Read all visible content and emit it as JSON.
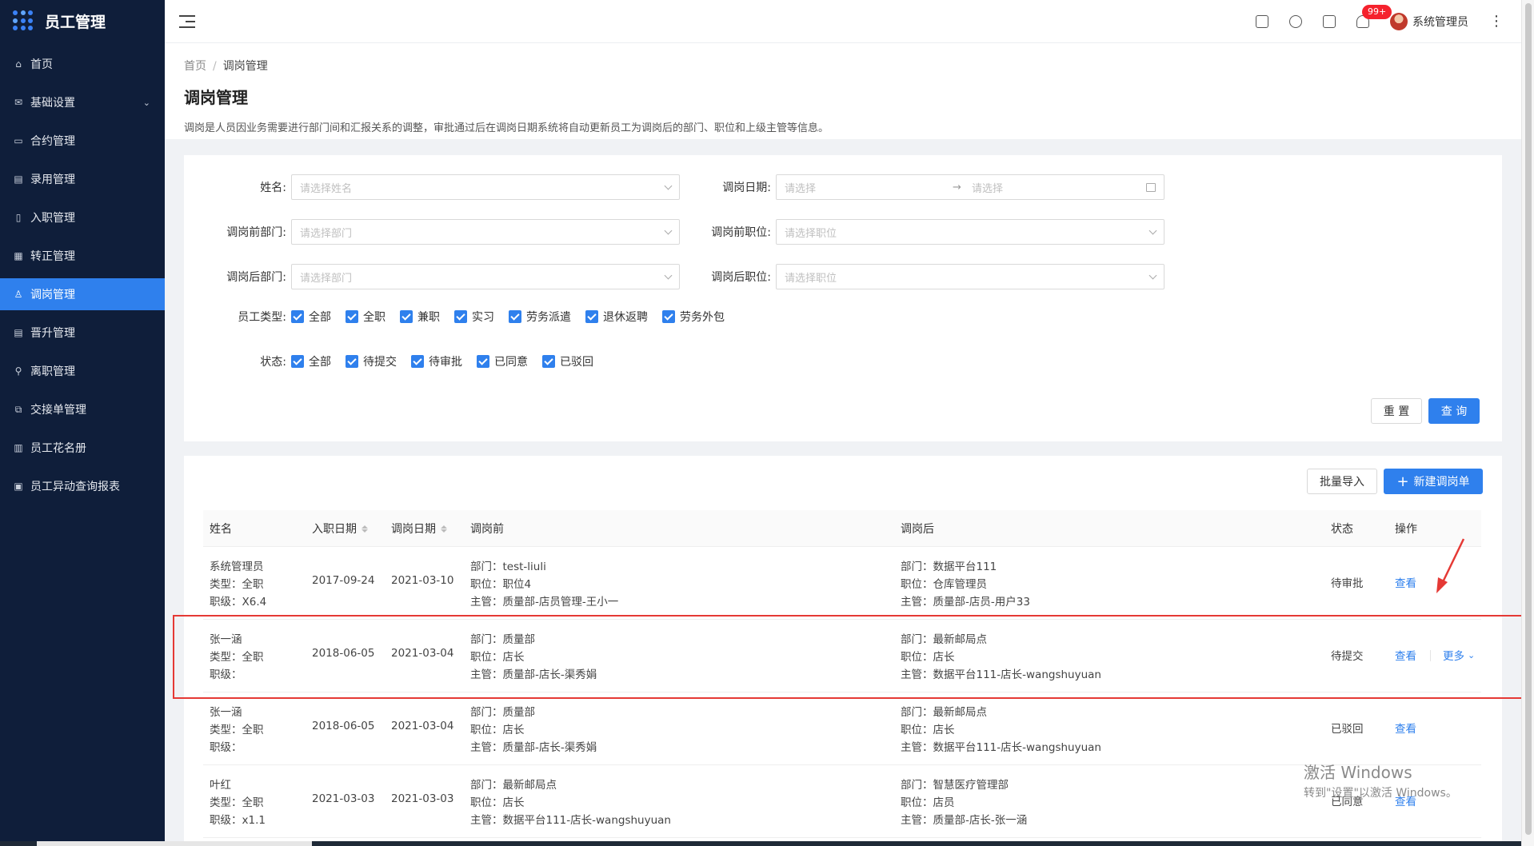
{
  "app": {
    "title": "员工管理"
  },
  "sidebar": {
    "items": [
      {
        "label": "首页",
        "icon": "home-icon"
      },
      {
        "label": "基础设置",
        "icon": "mail-icon",
        "has_caret": true
      },
      {
        "label": "合约管理",
        "icon": "calendar-icon"
      },
      {
        "label": "录用管理",
        "icon": "doc-icon"
      },
      {
        "label": "入职管理",
        "icon": "file-icon"
      },
      {
        "label": "转正管理",
        "icon": "grid-icon"
      },
      {
        "label": "调岗管理",
        "icon": "user-icon",
        "active": true
      },
      {
        "label": "晋升管理",
        "icon": "doc-icon"
      },
      {
        "label": "离职管理",
        "icon": "leave-icon"
      },
      {
        "label": "交接单管理",
        "icon": "copy-icon"
      },
      {
        "label": "员工花名册",
        "icon": "book-icon"
      },
      {
        "label": "员工异动查询报表",
        "icon": "report-icon"
      }
    ]
  },
  "header": {
    "notification_badge": "99+",
    "user_name": "系统管理员"
  },
  "breadcrumb": {
    "home": "首页",
    "current": "调岗管理",
    "separator": "/"
  },
  "page": {
    "title": "调岗管理",
    "description": "调岗是人员因业务需要进行部门间和汇报关系的调整，审批通过后在调岗日期系统将自动更新员工为调岗后的部门、职位和上级主管等信息。"
  },
  "filters": {
    "name_label": "姓名:",
    "name_placeholder": "请选择姓名",
    "date_label": "调岗日期:",
    "date_start_placeholder": "请选择",
    "date_end_placeholder": "请选择",
    "date_arrow": "→",
    "before_dept_label": "调岗前部门:",
    "before_dept_placeholder": "请选择部门",
    "before_pos_label": "调岗前职位:",
    "before_pos_placeholder": "请选择职位",
    "after_dept_label": "调岗后部门:",
    "after_dept_placeholder": "请选择部门",
    "after_pos_label": "调岗后职位:",
    "after_pos_placeholder": "请选择职位",
    "emp_type_label": "员工类型:",
    "emp_types": [
      "全部",
      "全职",
      "兼职",
      "实习",
      "劳务派遣",
      "退休返聘",
      "劳务外包"
    ],
    "status_label": "状态:",
    "statuses": [
      "全部",
      "待提交",
      "待审批",
      "已同意",
      "已驳回"
    ],
    "reset": "重 置",
    "query": "查 询"
  },
  "toolbar": {
    "import": "批量导入",
    "create": "新建调岗单",
    "create_icon": "+"
  },
  "table": {
    "columns": {
      "name": "姓名",
      "hire_date": "入职日期",
      "transfer_date": "调岗日期",
      "before": "调岗前",
      "after": "调岗后",
      "status": "状态",
      "action": "操作"
    },
    "rows": [
      {
        "name": "系统管理员",
        "type": "类型：全职",
        "level": "职级：X6.4",
        "hire_date": "2017-09-24",
        "transfer_date": "2021-03-10",
        "before_dept": "部门：test-liuli",
        "before_pos": "职位：职位4",
        "before_mgr": "主管：质量部-店员管理-王小一",
        "after_dept": "部门：数据平台111",
        "after_pos": "职位：仓库管理员",
        "after_mgr": "主管：质量部-店员-用户33",
        "status": "待审批",
        "view": "查看"
      },
      {
        "name": "张一涵",
        "type": "类型：全职",
        "level": "职级：",
        "hire_date": "2018-06-05",
        "transfer_date": "2021-03-04",
        "before_dept": "部门：质量部",
        "before_pos": "职位：店长",
        "before_mgr": "主管：质量部-店长-渠秀娟",
        "after_dept": "部门：最新邮局点",
        "after_pos": "职位：店长",
        "after_mgr": "主管：数据平台111-店长-wangshuyuan",
        "status": "待提交",
        "view": "查看",
        "more": "更多"
      },
      {
        "name": "张一涵",
        "type": "类型：全职",
        "level": "职级：",
        "hire_date": "2018-06-05",
        "transfer_date": "2021-03-04",
        "before_dept": "部门：质量部",
        "before_pos": "职位：店长",
        "before_mgr": "主管：质量部-店长-渠秀娟",
        "after_dept": "部门：最新邮局点",
        "after_pos": "职位：店长",
        "after_mgr": "主管：数据平台111-店长-wangshuyuan",
        "status": "已驳回",
        "view": "查看"
      },
      {
        "name": "叶红",
        "type": "类型：全职",
        "level": "职级：x1.1",
        "hire_date": "2021-03-03",
        "transfer_date": "2021-03-03",
        "before_dept": "部门：最新邮局点",
        "before_pos": "职位：店长",
        "before_mgr": "主管：数据平台111-店长-wangshuyuan",
        "after_dept": "部门：智慧医疗管理部",
        "after_pos": "职位：店员",
        "after_mgr": "主管：质量部-店长-张一涵",
        "status": "已同意",
        "view": "查看"
      }
    ]
  },
  "watermark": {
    "line1": "激活 Windows",
    "line2": "转到\"设置\"以激活 Windows。"
  },
  "colors": {
    "primary": "#2f80ed",
    "sidebar_bg": "#0f1e3a",
    "highlight": "#e53935",
    "badge": "#f5222d"
  }
}
